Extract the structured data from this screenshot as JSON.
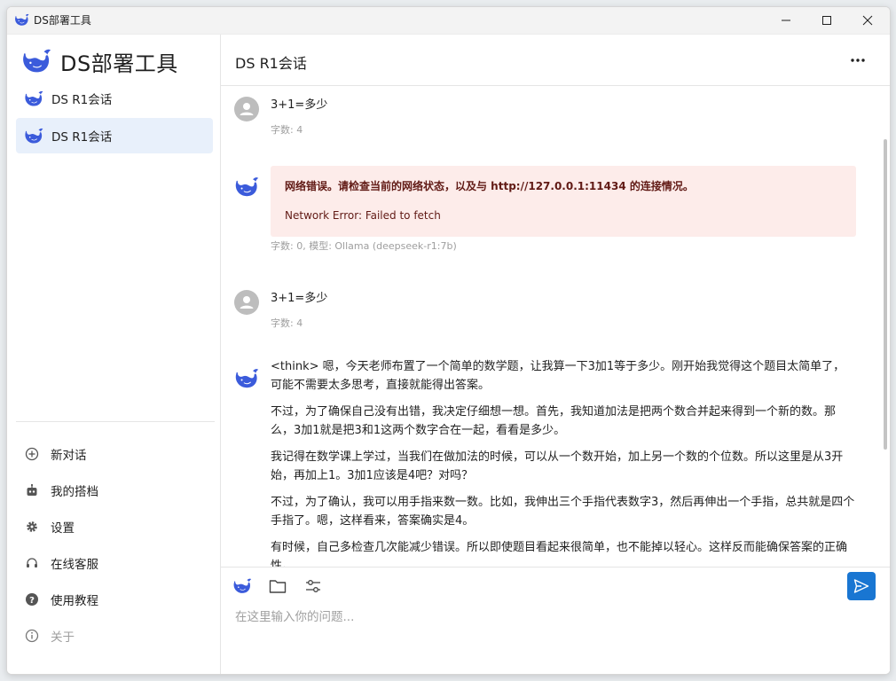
{
  "window": {
    "title": "DS部署工具"
  },
  "brand": {
    "name": "DS部署工具"
  },
  "sessions": [
    {
      "label": "DS R1会话",
      "selected": false
    },
    {
      "label": "DS R1会话",
      "selected": true
    }
  ],
  "menu": {
    "new_chat": "新对话",
    "my_agents": "我的搭档",
    "settings": "设置",
    "support": "在线客服",
    "tutorial": "使用教程",
    "about": "关于"
  },
  "conversation": {
    "title": "DS R1会话"
  },
  "messages": {
    "m1": {
      "text": "3+1=多少",
      "meta": "字数: 4"
    },
    "m2": {
      "error_title": "网络错误。请检查当前的网络状态，以及与 http://127.0.0.1:11434 的连接情况。",
      "error_detail": "Network Error: Failed to fetch",
      "meta": "字数: 0, 模型: Ollama (deepseek-r1:7b)"
    },
    "m3": {
      "text": "3+1=多少",
      "meta": "字数: 4"
    },
    "m4": {
      "paragraphs": [
        "<think> 嗯，今天老师布置了一个简单的数学题，让我算一下3加1等于多少。刚开始我觉得这个题目太简单了，可能不需要太多思考，直接就能得出答案。",
        "不过，为了确保自己没有出错，我决定仔细想一想。首先，我知道加法是把两个数合并起来得到一个新的数。那么，3加1就是把3和1这两个数字合在一起，看看是多少。",
        "我记得在数学课上学过，当我们在做加法的时候，可以从一个数开始，加上另一个数的个位数。所以这里是从3开始，再加上1。3加1应该是4吧？对吗？",
        "不过，为了确认，我可以用手指来数一数。比如，我伸出三个手指代表数字3，然后再伸出一个手指，总共就是四个手指了。嗯，这样看来，答案确实是4。",
        "有时候，自己多检查几次能减少错误。所以即使题目看起来很简单，也不能掉以轻心。这样反而能确保答案的正确性。"
      ]
    }
  },
  "composer": {
    "placeholder": "在这里输入你的问题..."
  },
  "colors": {
    "accent": "#1976d2",
    "selected_bg": "#e8f0fb",
    "error_bg": "#fdecea",
    "error_text": "#611a15",
    "whale": "#3b5bdb"
  }
}
